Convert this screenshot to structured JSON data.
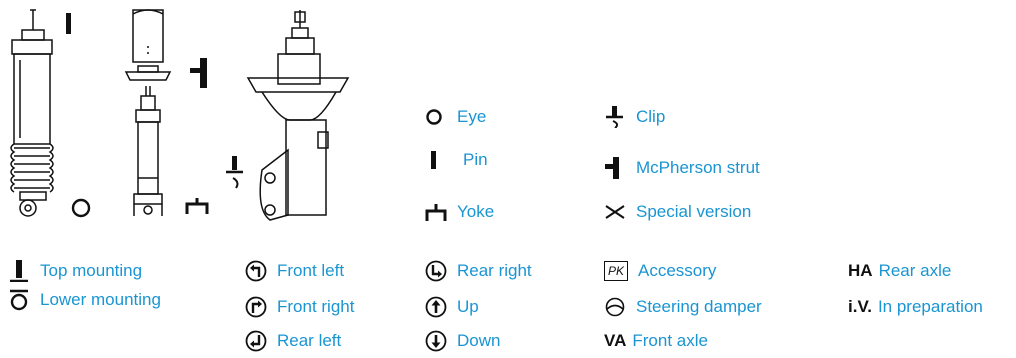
{
  "legend_main": {
    "eye": "Eye",
    "pin": "Pin",
    "yoke": "Yoke",
    "clip": "Clip",
    "mcpherson": "McPherson strut",
    "special": "Special version"
  },
  "legend_bottom": {
    "top_mounting": "Top mounting",
    "lower_mounting": "Lower mounting",
    "front_left": "Front left",
    "front_right": "Front right",
    "rear_left": "Rear left",
    "rear_right": "Rear right",
    "up": "Up",
    "down": "Down",
    "accessory": "Accessory",
    "accessory_abbr": "PK",
    "steering_damper": "Steering damper",
    "front_axle_abbr": "VA",
    "front_axle": "Front axle",
    "rear_axle_abbr": "HA",
    "rear_axle": "Rear axle",
    "in_prep_abbr": "i.V.",
    "in_prep": "In preparation"
  },
  "colors": {
    "accent": "#1a95d2",
    "ink": "#111111"
  }
}
